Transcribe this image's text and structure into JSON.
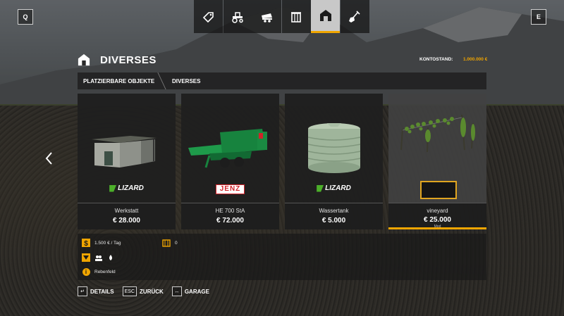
{
  "topbar": {
    "left_key": "Q",
    "right_key": "E",
    "tabs": [
      {
        "icon": "price-tag-icon",
        "active": false
      },
      {
        "icon": "tractor-icon",
        "active": false
      },
      {
        "icon": "trailer-icon",
        "active": false
      },
      {
        "icon": "silo-icon",
        "active": false
      },
      {
        "icon": "barn-icon",
        "active": true
      },
      {
        "icon": "shovel-icon",
        "active": false
      }
    ]
  },
  "header": {
    "title": "DIVERSES",
    "balance_label": "KONTOSTAND:",
    "balance_value": "1.000.000 €"
  },
  "breadcrumb": {
    "first": "PLATZIERBARE OBJEKTE",
    "second": "DIVERSES"
  },
  "items": [
    {
      "name": "Werkstatt",
      "price": "€ 28.000",
      "brand": "LIZARD",
      "selected": false
    },
    {
      "name": "HE 700 StA",
      "price": "€ 72.000",
      "brand": "JENZ",
      "selected": false
    },
    {
      "name": "Wassertank",
      "price": "€ 5.000",
      "brand": "LIZARD",
      "selected": false
    },
    {
      "name": "vineyard",
      "price": "€ 25.000",
      "badge": "Mod",
      "selected": true
    }
  ],
  "details": {
    "upkeep": "1.500 € / Tag",
    "capacity": "0",
    "description": "Rebenfeld"
  },
  "footer": {
    "details_key": "↵",
    "details_label": "DETAILS",
    "back_key": "ESC",
    "back_label": "ZURÜCK",
    "garage_key": "↔",
    "garage_label": "GARAGE"
  },
  "colors": {
    "accent": "#f0a500",
    "panel": "#1c1c1c",
    "lizard_green": "#4caf2a",
    "jenz_red": "#d2232a"
  }
}
